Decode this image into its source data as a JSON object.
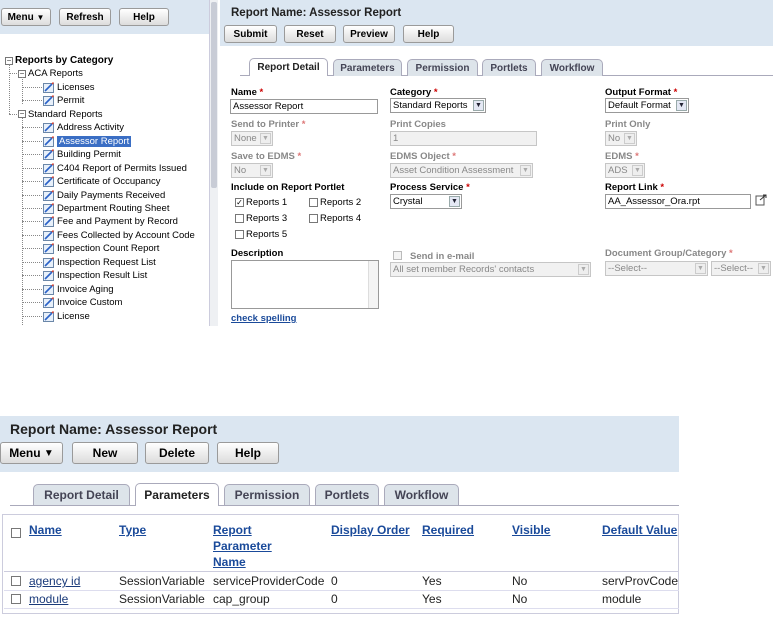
{
  "top_left": {
    "menu_label": "Menu",
    "refresh_label": "Refresh",
    "help_label": "Help"
  },
  "tree": {
    "root_label": "Reports by Category",
    "aca_label": "ACA Reports",
    "aca_items": [
      "Licenses",
      "Permit"
    ],
    "standard_label": "Standard Reports",
    "standard_items": [
      "Address Activity",
      "Assessor Report",
      "Building Permit",
      "C404 Report of Permits Issued",
      "Certificate of Occupancy",
      "Daily Payments Received",
      "Department Routing Sheet",
      "Fee and Payment by Record",
      "Fees Collected by Account Code",
      "Inspection Count Report",
      "Inspection Request List",
      "Inspection Result List",
      "Invoice Aging",
      "Invoice Custom",
      "License"
    ],
    "selected_item": "Assessor Report"
  },
  "detail": {
    "title": "Report Name: Assessor Report",
    "buttons": [
      "Submit",
      "Reset",
      "Preview",
      "Help"
    ],
    "tabs": [
      "Report Detail",
      "Parameters",
      "Permission",
      "Portlets",
      "Workflow"
    ],
    "active_tab": "Report Detail",
    "name_label": "Name",
    "name_value": "Assessor Report",
    "category_label": "Category",
    "category_value": "Standard Reports",
    "output_label": "Output Format",
    "output_value": "Default Format",
    "send_printer_label": "Send to Printer",
    "send_printer_value": "None",
    "print_copies_label": "Print Copies",
    "print_copies_value": "1",
    "print_only_label": "Print Only",
    "print_only_value": "No",
    "save_edms_label": "Save to EDMS",
    "save_edms_value": "No",
    "edms_object_label": "EDMS Object",
    "edms_object_value": "Asset Condition Assessment",
    "edms_label": "EDMS",
    "edms_value": "ADS",
    "portlet_label": "Include on Report Portlet",
    "portlets": [
      {
        "label": "Reports 1",
        "checked": "✓"
      },
      {
        "label": "Reports 2",
        "checked": ""
      },
      {
        "label": "Reports 3",
        "checked": ""
      },
      {
        "label": "Reports 4",
        "checked": ""
      },
      {
        "label": "Reports 5",
        "checked": ""
      }
    ],
    "process_label": "Process Service",
    "process_value": "Crystal",
    "report_link_label": "Report Link",
    "report_link_value": "AA_Assessor_Ora.rpt",
    "description_label": "Description",
    "send_email_label": "Send in e-mail",
    "email_value": "All set member Records' contacts",
    "doc_group_label": "Document Group/Category",
    "doc_select_1": "--Select--",
    "doc_select_2": "--Select--",
    "check_spelling": "check spelling",
    "required_mark": "*"
  },
  "params": {
    "title": "Report Name: Assessor Report",
    "buttons": [
      "Menu",
      "New",
      "Delete",
      "Help"
    ],
    "tabs": [
      "Report Detail",
      "Parameters",
      "Permission",
      "Portlets",
      "Workflow"
    ],
    "active_tab": "Parameters",
    "columns": [
      "Name",
      "Type",
      "Report Parameter Name",
      "Display Order",
      "Required",
      "Visible",
      "Default Value"
    ],
    "rows": [
      [
        "agency id",
        "SessionVariable",
        "serviceProviderCode",
        "0",
        "Yes",
        "No",
        "servProvCode"
      ],
      [
        "module",
        "SessionVariable",
        "cap_group",
        "0",
        "Yes",
        "No",
        "module"
      ]
    ]
  },
  "colors": {
    "header_bg": "#dbe6f1",
    "link": "#1a4a9a",
    "tab_bg": "#dde4ea"
  }
}
